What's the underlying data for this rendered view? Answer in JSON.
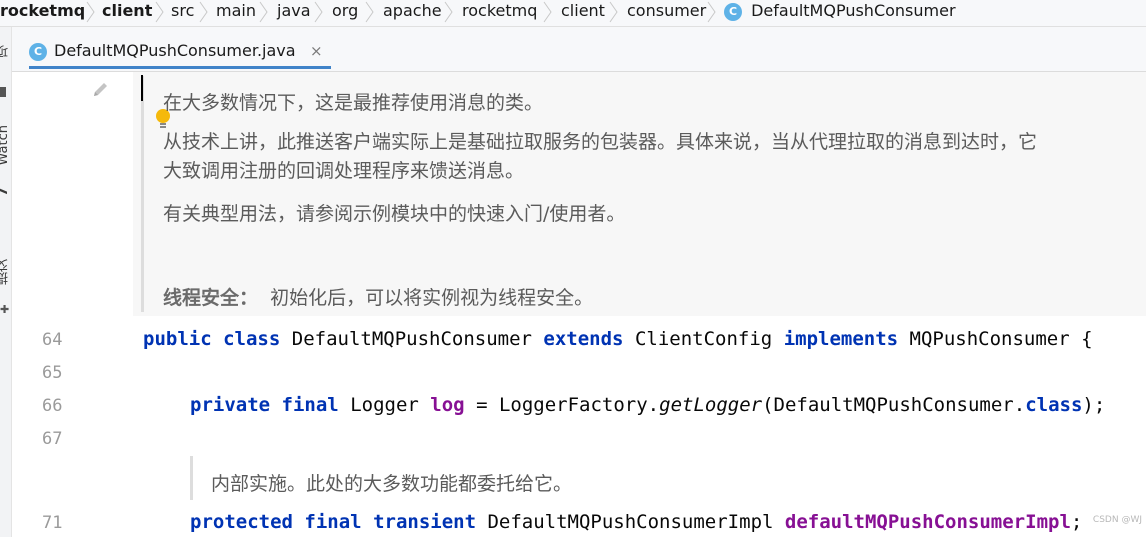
{
  "breadcrumb": {
    "items": [
      "rocketmq",
      "client",
      "src",
      "main",
      "java",
      "org",
      "apache",
      "rocketmq",
      "client",
      "consumer",
      "DefaultMQPushConsumer"
    ],
    "class_icon_letter": "C"
  },
  "left_strip": {
    "items": [
      "项",
      "Watch",
      "7",
      "提交"
    ]
  },
  "tab": {
    "label": "DefaultMQPushConsumer.java",
    "icon_letter": "C",
    "close": "×"
  },
  "doc_comment": {
    "line1": "在大多数情况下，这是最推荐使用消息的类。",
    "line2": "从技术上讲，此推送客户端实际上是基础拉取服务的包装器。具体来说，当从代理拉取的消息到达时，它",
    "line3": "大致调用注册的回调处理程序来馈送消息。",
    "line4": "有关典型用法，请参阅示例模块中的快速入门/使用者。",
    "thread_safety_label": "线程安全：",
    "thread_safety_text": "初始化后，可以将实例视为线程安全。"
  },
  "code": {
    "line64": {
      "number": "64",
      "kw_public": "public",
      "kw_class": "class",
      "class_name": "DefaultMQPushConsumer",
      "kw_extends": "extends",
      "parent": "ClientConfig",
      "kw_implements": "implements",
      "iface": "MQPushConsumer",
      "brace": "{"
    },
    "line65": {
      "number": "65"
    },
    "line66": {
      "number": "66",
      "kw_private": "private",
      "kw_final": "final",
      "type": "Logger",
      "field": "log",
      "eq": "=",
      "factory": "LoggerFactory.",
      "method": "getLogger",
      "arg": "(DefaultMQPushConsumer.",
      "kw_class": "class",
      "end": ");"
    },
    "line67": {
      "number": "67"
    },
    "inline_doc": "内部实施。此处的大多数功能都委托给它。",
    "line71": {
      "number": "71",
      "kw_protected": "protected",
      "kw_final": "final",
      "kw_transient": "transient",
      "type": "DefaultMQPushConsumerImpl",
      "field": "defaultMQPushConsumerImpl",
      "end": ";"
    }
  },
  "watermark": "CSDN @WJ",
  "colors": {
    "keyword": "#0033b3",
    "field": "#871094",
    "tab_underline": "#4083c9",
    "class_icon": "#5eb2e7"
  }
}
